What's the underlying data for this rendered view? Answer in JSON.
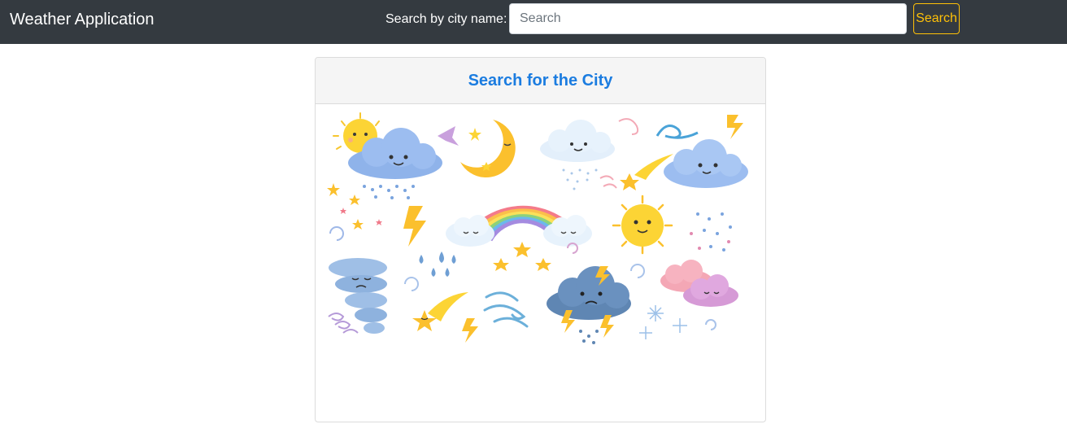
{
  "navbar": {
    "brand": "Weather Application",
    "search_label": "Search by city name:",
    "search_placeholder": "Search",
    "search_value": "",
    "search_button": "Search"
  },
  "card": {
    "title": "Search for the City"
  },
  "colors": {
    "navbar_bg": "#343a40",
    "accent_button": "#ffc107",
    "title_link": "#1b7ce0",
    "card_header_bg": "#f5f5f5"
  },
  "illustration": {
    "name": "weather-icons-cartoon",
    "icons": [
      "sun-icon",
      "cloud-rain-icon",
      "moon-icon",
      "rainbow-icon",
      "lightning-icon",
      "tornado-icon",
      "shooting-star-icon",
      "wind-icon",
      "storm-cloud-icon",
      "snowflake-icon",
      "star-icon"
    ]
  }
}
